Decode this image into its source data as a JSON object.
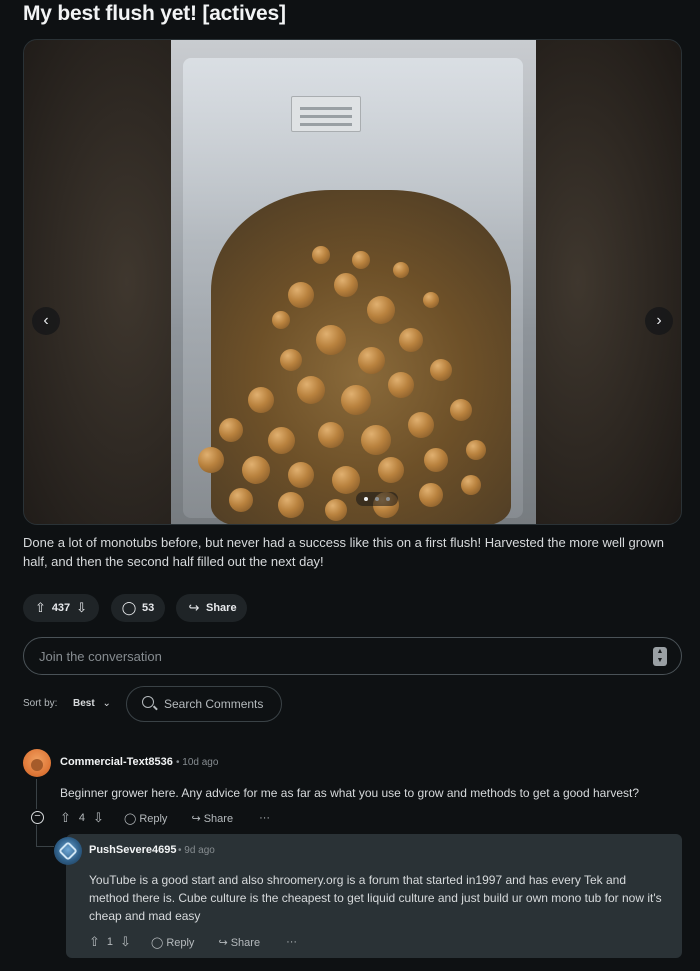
{
  "post": {
    "title": "My best flush yet! [actives]",
    "body": "Done a lot of monotubs before, but never had a success like this on a first flush! Harvested the more well grown half, and then the second half filled out the next day!",
    "gallery": {
      "prev_icon": "chevron-left-icon",
      "next_icon": "chevron-right-icon",
      "current_index": 1,
      "total": 3
    },
    "actions": {
      "votes": "437",
      "comments": "53",
      "share_label": "Share"
    }
  },
  "comment_input": {
    "placeholder": "Join the conversation"
  },
  "sort": {
    "label": "Sort by:",
    "value": "Best",
    "search_placeholder": "Search Comments"
  },
  "comments": [
    {
      "author": "Commercial-Text8536",
      "time": "• 10d ago",
      "text": "Beginner grower here. Any advice for me as far as what you use to grow and methods to get a good harvest?",
      "votes": "4",
      "reply_label": "Reply",
      "share_label": "Share",
      "more_label": "···"
    },
    {
      "author": "PushSevere4695",
      "time": "• 9d ago",
      "text": "YouTube is a good start and also shroomery.org is a forum that started in1997 and has every Tek and method there is. Cube culture is the cheapest to get liquid culture and just build ur own mono tub for now it's cheap and mad easy",
      "votes": "1",
      "reply_label": "Reply",
      "share_label": "Share",
      "more_label": "···"
    }
  ],
  "colors": {
    "background": "#0e1113",
    "pill": "#1f2427",
    "reply_bg": "#2a3236",
    "text": "#d7dadc"
  }
}
